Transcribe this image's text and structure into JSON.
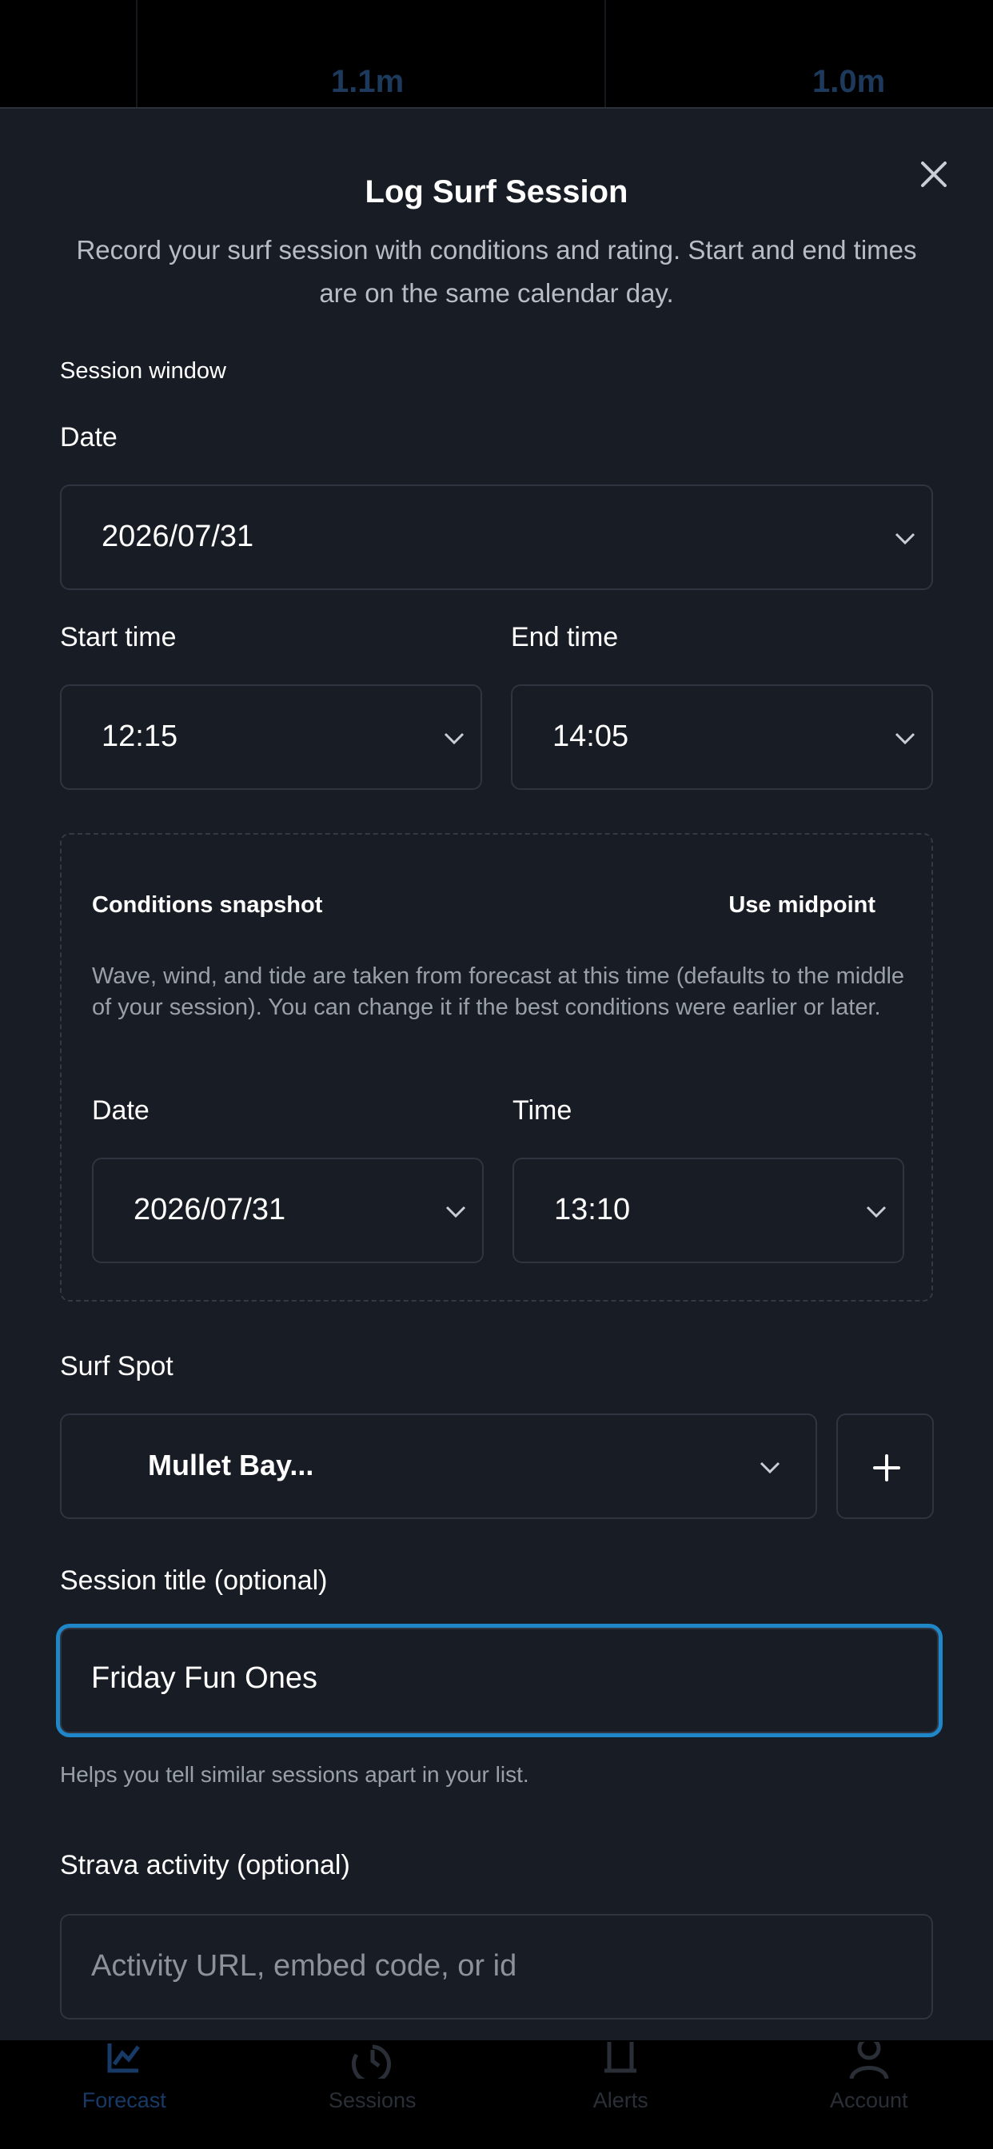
{
  "background": {
    "wave_heights": [
      "1.1m",
      "1.0m"
    ],
    "tabs": [
      {
        "label": "Forecast",
        "icon": "chart-icon",
        "active": true
      },
      {
        "label": "Sessions",
        "icon": "history-icon",
        "active": false
      },
      {
        "label": "Alerts",
        "icon": "bell-icon",
        "active": false
      },
      {
        "label": "Account",
        "icon": "user-icon",
        "active": false
      }
    ]
  },
  "modal": {
    "title": "Log Surf Session",
    "subtitle": "Record your surf session with conditions and rating. Start and end times are on the same calendar day.",
    "session_window_label": "Session window",
    "date_label": "Date",
    "date_value": "2026/07/31",
    "start_time_label": "Start time",
    "start_time_value": "12:15",
    "end_time_label": "End time",
    "end_time_value": "14:05",
    "snapshot": {
      "title": "Conditions snapshot",
      "button": "Use midpoint",
      "description": "Wave, wind, and tide are taken from forecast at this time (defaults to the middle of your session). You can change it if the best conditions were earlier or later.",
      "date_label": "Date",
      "date_value": "2026/07/31",
      "time_label": "Time",
      "time_value": "13:10"
    },
    "spot_label": "Surf Spot",
    "spot_value": "Mullet Bay...",
    "title_field_label": "Session title (optional)",
    "title_field_value": "Friday Fun Ones",
    "title_helper": "Helps you tell similar sessions apart in your list.",
    "strava_label": "Strava activity (optional)",
    "strava_placeholder": "Activity URL, embed code, or id"
  },
  "colors": {
    "sheet_bg": "#181c24",
    "field_border": "#2e3440",
    "focus_ring": "#1f86c8",
    "muted_text": "#9aa0aa"
  }
}
